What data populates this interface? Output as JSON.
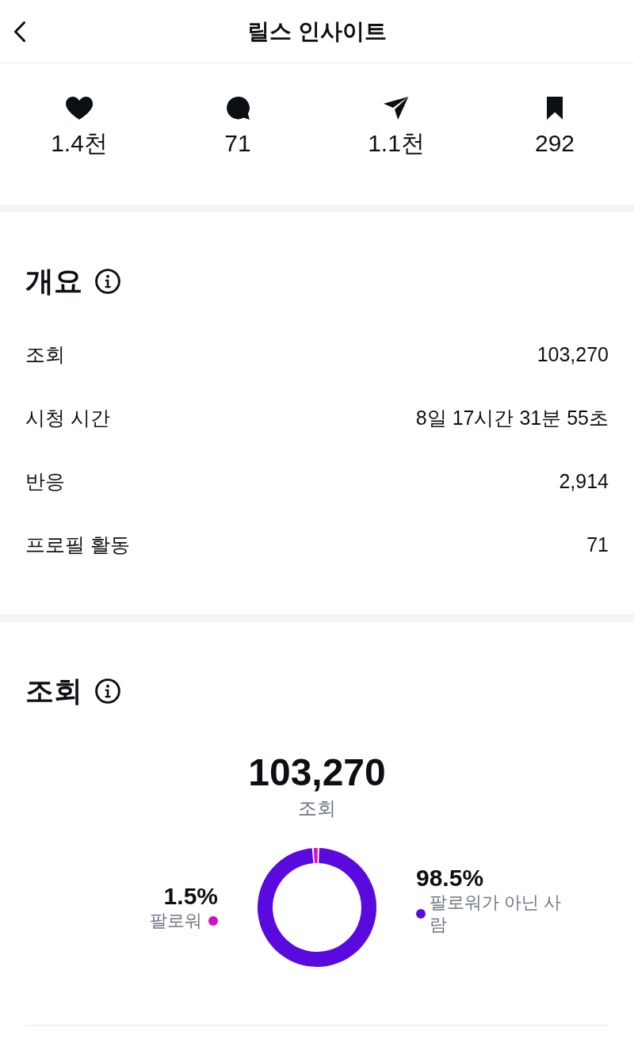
{
  "header": {
    "title": "릴스 인사이트"
  },
  "engagement": [
    {
      "kind": "like",
      "value": "1.4천"
    },
    {
      "kind": "comment",
      "value": "71"
    },
    {
      "kind": "share",
      "value": "1.1천"
    },
    {
      "kind": "save",
      "value": "292"
    }
  ],
  "overview": {
    "title": "개요",
    "rows": [
      {
        "label": "조회",
        "value": "103,270"
      },
      {
        "label": "시청 시간",
        "value": "8일 17시간 31분 55초"
      },
      {
        "label": "반응",
        "value": "2,914"
      },
      {
        "label": "프로필 활동",
        "value": "71"
      }
    ]
  },
  "views": {
    "title": "조회",
    "total": "103,270",
    "total_label": "조회",
    "legend": [
      {
        "percent": "1.5%",
        "color": "#d10fc8"
      },
      {
        "percent": "98.5%",
        "color": "#5a0adf"
      }
    ],
    "chart_data": {
      "type": "donut",
      "categories": [
        "팔로워",
        "팔로워가 아닌 사람"
      ],
      "values": [
        1.5,
        98.5
      ]
    }
  }
}
